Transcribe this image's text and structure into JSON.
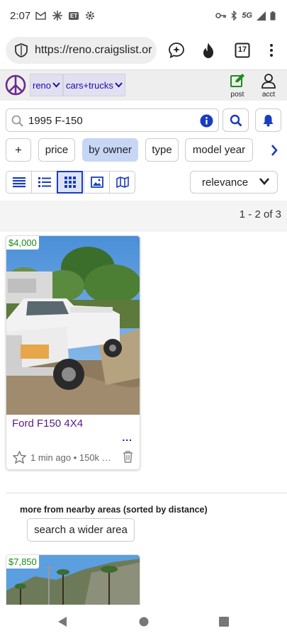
{
  "status_bar": {
    "time": "2:07",
    "network": "5G",
    "icons": [
      "gmail-icon",
      "pinwheel-icon",
      "et-icon",
      "settings-icon",
      "key-icon",
      "bluetooth-icon",
      "signal-icon",
      "battery-icon"
    ],
    "et_label": "ET"
  },
  "browser": {
    "url": "https://reno.craigslist.or",
    "tab_count": "17"
  },
  "header": {
    "location": "reno",
    "category": "cars+trucks",
    "post_label": "post",
    "acct_label": "acct",
    "accent": "#1a0dab",
    "logo_color": "#6b2c91"
  },
  "search": {
    "query": "1995 F-150"
  },
  "filters": {
    "add": "+",
    "items": [
      "price",
      "by owner",
      "type",
      "model year"
    ],
    "active": "by owner",
    "active_color": "#c7d6f5"
  },
  "view": {
    "modes": [
      "list-view",
      "preview-view",
      "grid-view",
      "gallery-view",
      "map-view"
    ],
    "active": "grid-view",
    "sort": "relevance"
  },
  "results": {
    "count_text": "1 - 2 of 3"
  },
  "listings": [
    {
      "price": "$4,000",
      "title": "Ford F150 4X4",
      "more": "...",
      "meta": "1 min ago • 150k …"
    }
  ],
  "nearby": {
    "heading": "more from nearby areas (sorted by distance)",
    "button": "search a wider area",
    "listings": [
      {
        "price": "$7,850"
      }
    ]
  },
  "colors": {
    "price_green": "#1a8a1a",
    "title_purple": "#551a8b",
    "link_blue": "#1a3cbf"
  }
}
